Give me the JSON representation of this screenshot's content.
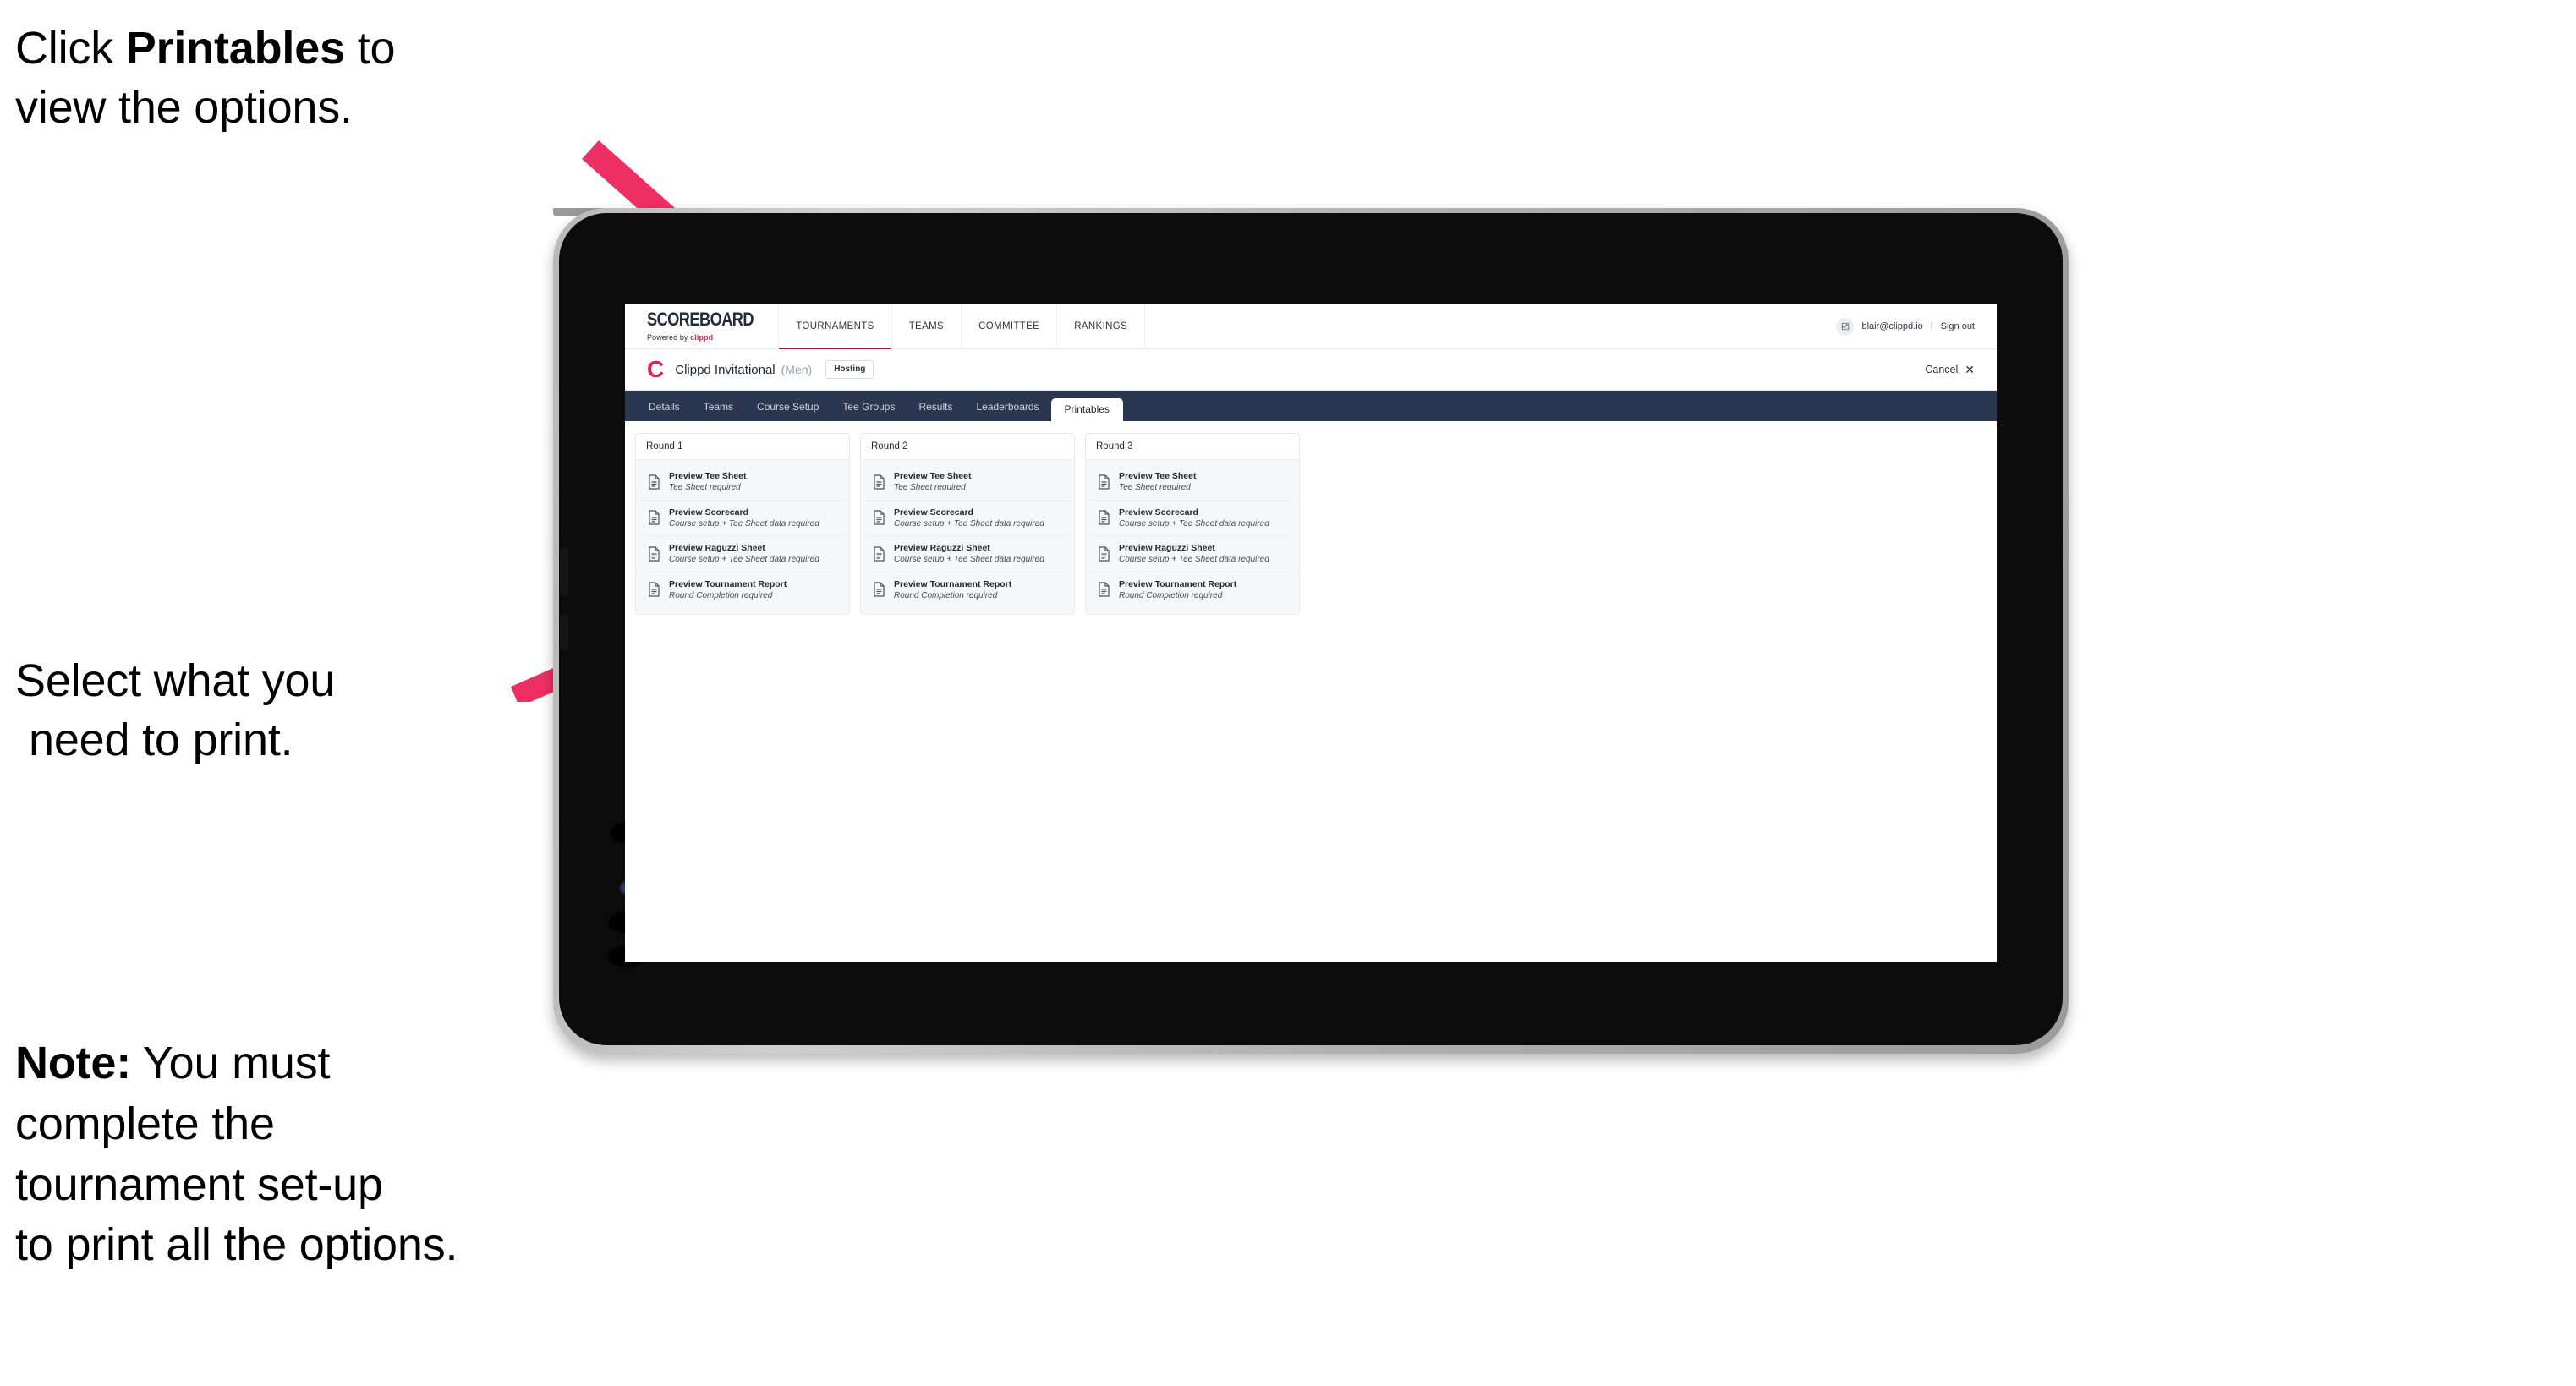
{
  "annotations": {
    "click_printables": {
      "line1_prefix": "Click ",
      "line1_bold": "Printables",
      "line1_suffix": " to",
      "line2": "view the options."
    },
    "select_print": {
      "line1": "Select what you",
      "line2": "need to print."
    },
    "note": {
      "label": "Note:",
      "line1_rest": " You must",
      "line2": "complete the",
      "line3": "tournament set-up",
      "line4": "to print all the options."
    },
    "arrow_color": "#ee2f63"
  },
  "app": {
    "global_nav": {
      "brand": {
        "word": "SCOREBOARD",
        "powered_prefix": "Powered by ",
        "powered_brand": "clippd"
      },
      "links": [
        {
          "label": "TOURNAMENTS",
          "active": true
        },
        {
          "label": "TEAMS",
          "active": false
        },
        {
          "label": "COMMITTEE",
          "active": false
        },
        {
          "label": "RANKINGS",
          "active": false
        }
      ],
      "account": {
        "avatar_icon": "user-avatar-icon",
        "email": "blair@clippd.io",
        "separator": "|",
        "sign_out": "Sign out"
      }
    },
    "title_bar": {
      "logo_mark": "C",
      "tournament_name": "Clippd Invitational",
      "gender": "(Men)",
      "status_chip": "Hosting",
      "cancel_label": "Cancel",
      "cancel_icon": "close-icon"
    },
    "tabs": [
      {
        "label": "Details",
        "active": false
      },
      {
        "label": "Teams",
        "active": false
      },
      {
        "label": "Course Setup",
        "active": false
      },
      {
        "label": "Tee Groups",
        "active": false
      },
      {
        "label": "Results",
        "active": false
      },
      {
        "label": "Leaderboards",
        "active": false
      },
      {
        "label": "Printables",
        "active": true
      }
    ],
    "rounds": [
      {
        "title": "Round 1",
        "items": [
          {
            "title": "Preview Tee Sheet",
            "subtitle": "Tee Sheet required"
          },
          {
            "title": "Preview Scorecard",
            "subtitle": "Course setup + Tee Sheet data required"
          },
          {
            "title": "Preview Raguzzi Sheet",
            "subtitle": "Course setup + Tee Sheet data required"
          },
          {
            "title": "Preview Tournament Report",
            "subtitle": "Round Completion required"
          }
        ]
      },
      {
        "title": "Round 2",
        "items": [
          {
            "title": "Preview Tee Sheet",
            "subtitle": "Tee Sheet required"
          },
          {
            "title": "Preview Scorecard",
            "subtitle": "Course setup + Tee Sheet data required"
          },
          {
            "title": "Preview Raguzzi Sheet",
            "subtitle": "Course setup + Tee Sheet data required"
          },
          {
            "title": "Preview Tournament Report",
            "subtitle": "Round Completion required"
          }
        ]
      },
      {
        "title": "Round 3",
        "items": [
          {
            "title": "Preview Tee Sheet",
            "subtitle": "Tee Sheet required"
          },
          {
            "title": "Preview Scorecard",
            "subtitle": "Course setup + Tee Sheet data required"
          },
          {
            "title": "Preview Raguzzi Sheet",
            "subtitle": "Course setup + Tee Sheet data required"
          },
          {
            "title": "Preview Tournament Report",
            "subtitle": "Round Completion required"
          }
        ]
      }
    ]
  },
  "colors": {
    "accent_pink": "#e0205a",
    "tabbar_dark": "#2b3650",
    "nav_underline": "#a02040",
    "card_bg": "#f6f7f9"
  }
}
